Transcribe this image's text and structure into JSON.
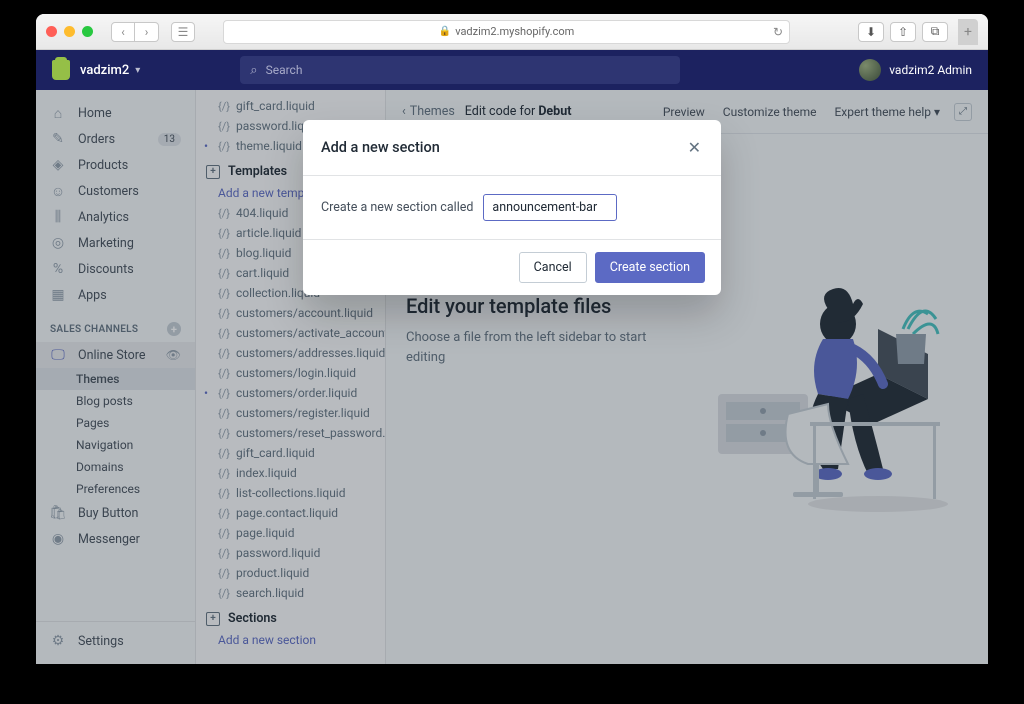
{
  "browser": {
    "url": "vadzim2.myshopify.com"
  },
  "header": {
    "store": "vadzim2",
    "search_placeholder": "Search",
    "user": "vadzim2 Admin"
  },
  "sidebar": {
    "items": [
      {
        "label": "Home",
        "icon": "home"
      },
      {
        "label": "Orders",
        "icon": "orders",
        "badge": "13"
      },
      {
        "label": "Products",
        "icon": "tag"
      },
      {
        "label": "Customers",
        "icon": "user"
      },
      {
        "label": "Analytics",
        "icon": "chart"
      },
      {
        "label": "Marketing",
        "icon": "target"
      },
      {
        "label": "Discounts",
        "icon": "percent"
      },
      {
        "label": "Apps",
        "icon": "apps"
      }
    ],
    "channels_label": "SALES CHANNELS",
    "channels": [
      {
        "label": "Online Store",
        "icon": "store",
        "sub": [
          {
            "label": "Themes",
            "active": true
          },
          {
            "label": "Blog posts"
          },
          {
            "label": "Pages"
          },
          {
            "label": "Navigation"
          },
          {
            "label": "Domains"
          },
          {
            "label": "Preferences"
          }
        ]
      },
      {
        "label": "Buy Button",
        "icon": "bag"
      },
      {
        "label": "Messenger",
        "icon": "msg"
      }
    ],
    "settings": "Settings"
  },
  "topbar": {
    "back": "Themes",
    "title": "Edit code for ",
    "theme_name": "Debut",
    "actions": [
      "Preview",
      "Customize theme",
      "Expert theme help"
    ]
  },
  "tree": {
    "files_top": [
      {
        "label": "gift_card.liquid"
      },
      {
        "label": "password.liquid"
      },
      {
        "label": "theme.liquid",
        "dotted": true
      }
    ],
    "templates_label": "Templates",
    "add_template": "Add a new template",
    "templates": [
      "404.liquid",
      "article.liquid",
      "blog.liquid",
      "cart.liquid",
      "collection.liquid",
      "customers/account.liquid",
      "customers/activate_account.liquid",
      "customers/addresses.liquid",
      "customers/login.liquid",
      "customers/order.liquid",
      "customers/register.liquid",
      "customers/reset_password.liquid",
      "gift_card.liquid",
      "index.liquid",
      "list-collections.liquid",
      "page.contact.liquid",
      "page.liquid",
      "password.liquid",
      "product.liquid",
      "search.liquid"
    ],
    "sections_label": "Sections",
    "add_section": "Add a new section"
  },
  "content": {
    "title": "Edit your template files",
    "sub": "Choose a file from the left sidebar to start editing"
  },
  "modal": {
    "title": "Add a new section",
    "label": "Create a new section called",
    "value": "announcement-bar",
    "cancel": "Cancel",
    "confirm": "Create section"
  }
}
